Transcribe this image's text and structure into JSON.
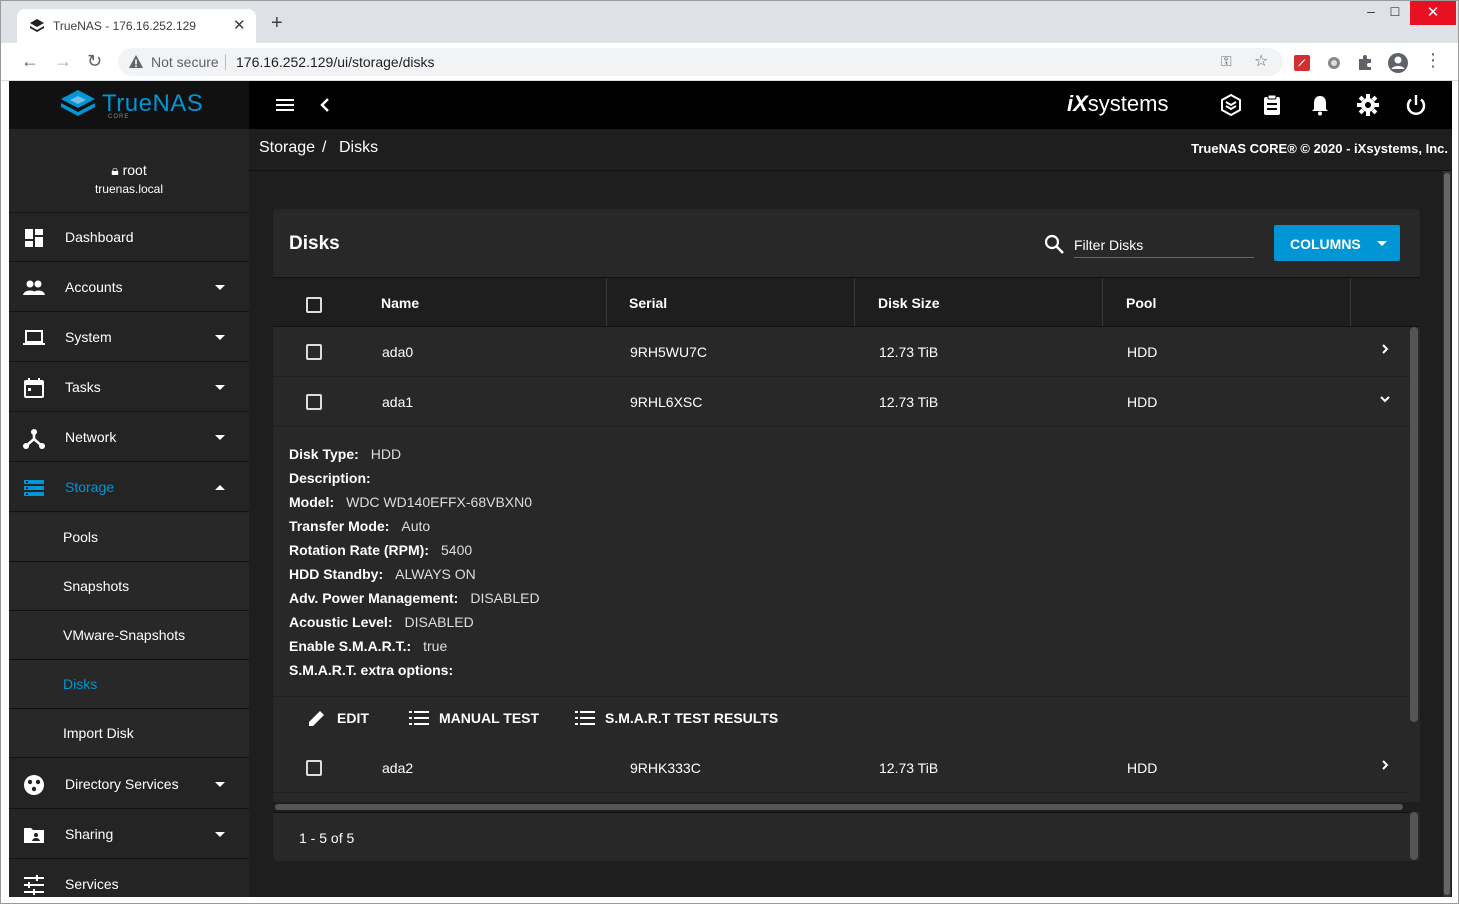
{
  "browser": {
    "tab_title": "TrueNAS - 176.16.252.129",
    "security_label": "Not secure",
    "url": "176.16.252.129/ui/storage/disks"
  },
  "brand": {
    "logo_text": "TrueNAS",
    "logo_sub": "CORE",
    "vendor_logo_left": "iX",
    "vendor_logo_right": "systems"
  },
  "user": {
    "name": "root",
    "host": "truenas.local"
  },
  "sidebar": {
    "items": [
      {
        "label": "Dashboard",
        "icon": "dashboard-icon"
      },
      {
        "label": "Accounts",
        "icon": "people-icon"
      },
      {
        "label": "System",
        "icon": "laptop-icon"
      },
      {
        "label": "Tasks",
        "icon": "calendar-icon"
      },
      {
        "label": "Network",
        "icon": "network-icon"
      },
      {
        "label": "Storage",
        "icon": "storage-icon"
      },
      {
        "label": "Directory Services",
        "icon": "directory-icon"
      },
      {
        "label": "Sharing",
        "icon": "folder-share-icon"
      },
      {
        "label": "Services",
        "icon": "tune-icon"
      }
    ],
    "storage_sub": [
      {
        "label": "Pools"
      },
      {
        "label": "Snapshots"
      },
      {
        "label": "VMware-Snapshots"
      },
      {
        "label": "Disks"
      },
      {
        "label": "Import Disk"
      }
    ]
  },
  "breadcrumb": {
    "parent": "Storage",
    "separator": "/",
    "current": "Disks"
  },
  "copyright": "TrueNAS CORE® © 2020 - iXsystems, Inc.",
  "card": {
    "title": "Disks",
    "filter_placeholder": "Filter Disks",
    "columns_label": "COLUMNS"
  },
  "table": {
    "headers": [
      "Name",
      "Serial",
      "Disk Size",
      "Pool"
    ],
    "rows": [
      {
        "name": "ada0",
        "serial": "9RH5WU7C",
        "size": "12.73 TiB",
        "pool": "HDD"
      },
      {
        "name": "ada1",
        "serial": "9RHL6XSC",
        "size": "12.73 TiB",
        "pool": "HDD"
      },
      {
        "name": "ada2",
        "serial": "9RHK333C",
        "size": "12.73 TiB",
        "pool": "HDD"
      }
    ]
  },
  "detail": {
    "lines": [
      {
        "key": "Disk Type:",
        "value": "HDD"
      },
      {
        "key": "Description:",
        "value": ""
      },
      {
        "key": "Model:",
        "value": "WDC WD140EFFX-68VBXN0"
      },
      {
        "key": "Transfer Mode:",
        "value": "Auto"
      },
      {
        "key": "Rotation Rate (RPM):",
        "value": "5400"
      },
      {
        "key": "HDD Standby:",
        "value": "ALWAYS ON"
      },
      {
        "key": "Adv. Power Management:",
        "value": "DISABLED"
      },
      {
        "key": "Acoustic Level:",
        "value": "DISABLED"
      },
      {
        "key": "Enable S.M.A.R.T.:",
        "value": "true"
      },
      {
        "key": "S.M.A.R.T. extra options:",
        "value": ""
      }
    ],
    "actions": {
      "edit": "EDIT",
      "manual_test": "MANUAL TEST",
      "smart_results": "S.M.A.R.T TEST RESULTS"
    }
  },
  "paginator": "1 - 5 of 5",
  "colors": {
    "accent": "#0095d5",
    "topbar": "#000000",
    "sidebar": "#242424",
    "card": "#282828"
  }
}
